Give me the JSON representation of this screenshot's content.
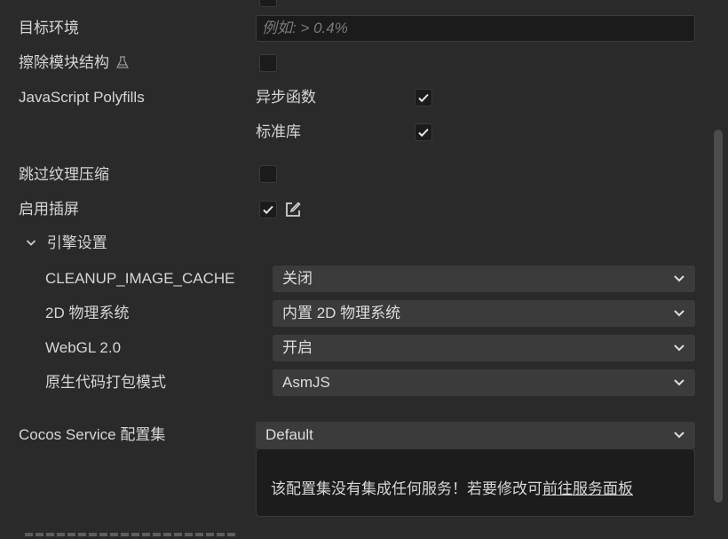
{
  "rows": {
    "target_env_label": "目标环境",
    "target_env_placeholder": "例如: > 0.4%",
    "erase_module_label": "擦除模块结构",
    "polyfills_label": "JavaScript Polyfills",
    "polyfill_async": "异步函数",
    "polyfill_stdlib": "标准库",
    "skip_texture_label": "跳过纹理压缩",
    "enable_splash_label": "启用插屏"
  },
  "engine": {
    "section_label": "引擎设置",
    "cleanup_label": "CLEANUP_IMAGE_CACHE",
    "cleanup_value": "关闭",
    "physics_label": "2D 物理系统",
    "physics_value": "内置 2D 物理系统",
    "webgl_label": "WebGL 2.0",
    "webgl_value": "开启",
    "native_label": "原生代码打包模式",
    "native_value": "AsmJS"
  },
  "cocos_service": {
    "label": "Cocos Service 配置集",
    "value": "Default",
    "notice_text": "该配置集没有集成任何服务！若要修改可",
    "notice_link": "前往服务面板"
  },
  "checkbox_states": {
    "top_partial": false,
    "erase_module": false,
    "polyfill_async": true,
    "polyfill_stdlib": true,
    "skip_texture": false,
    "enable_splash": true
  },
  "icons": [
    "flask-icon",
    "check-icon",
    "edit-icon",
    "chevron-down-icon",
    "expand-chevron-icon"
  ],
  "colors": {
    "background": "#2a2a2a",
    "select_bg": "#3b3b3b",
    "input_bg": "#1b1b1b",
    "text": "#d6d6d6"
  }
}
